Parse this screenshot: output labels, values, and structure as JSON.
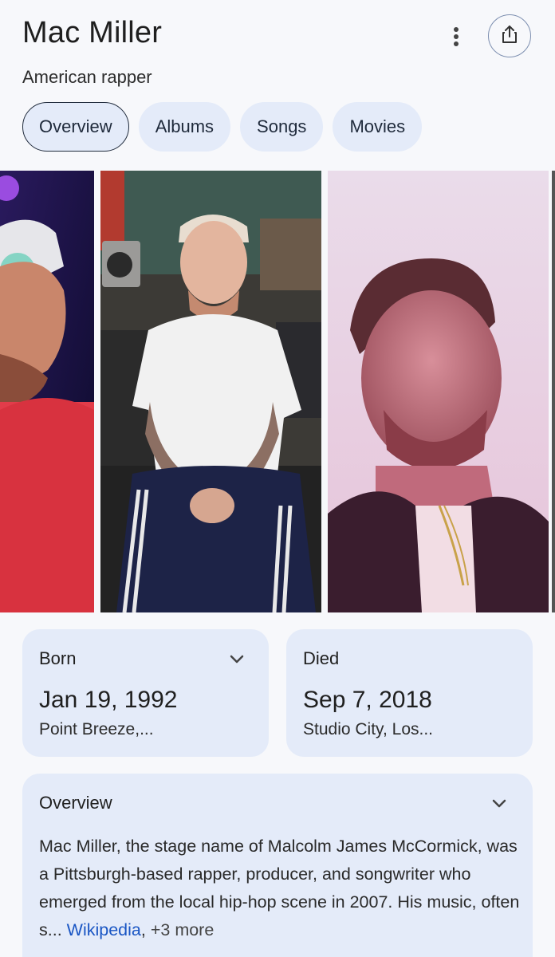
{
  "entity": {
    "title": "Mac Miller",
    "subtitle": "American rapper"
  },
  "header": {
    "more_icon": "more-vert-icon",
    "share_icon": "share-icon"
  },
  "tabs": [
    {
      "label": "Overview",
      "active": true
    },
    {
      "label": "Albums",
      "active": false
    },
    {
      "label": "Songs",
      "active": false
    },
    {
      "label": "Movies",
      "active": false
    }
  ],
  "facts": {
    "born": {
      "label": "Born",
      "date": "Jan 19, 1992",
      "place": "Point Breeze,..."
    },
    "died": {
      "label": "Died",
      "date": "Sep 7, 2018",
      "place": "Studio City, Los..."
    }
  },
  "overview": {
    "label": "Overview",
    "text": "Mac Miller, the stage name of Malcolm James McCormick, was a Pittsburgh-based rapper, producer, and songwriter who emerged from the local hip-hop scene in 2007. His music, often s...",
    "source_link": "Wikipedia",
    "separator": ",",
    "more_link": "+3 more"
  },
  "colors": {
    "accent": "#1a56c4",
    "card_bg": "#e4ebf9",
    "page_bg": "#f7f8fb"
  }
}
